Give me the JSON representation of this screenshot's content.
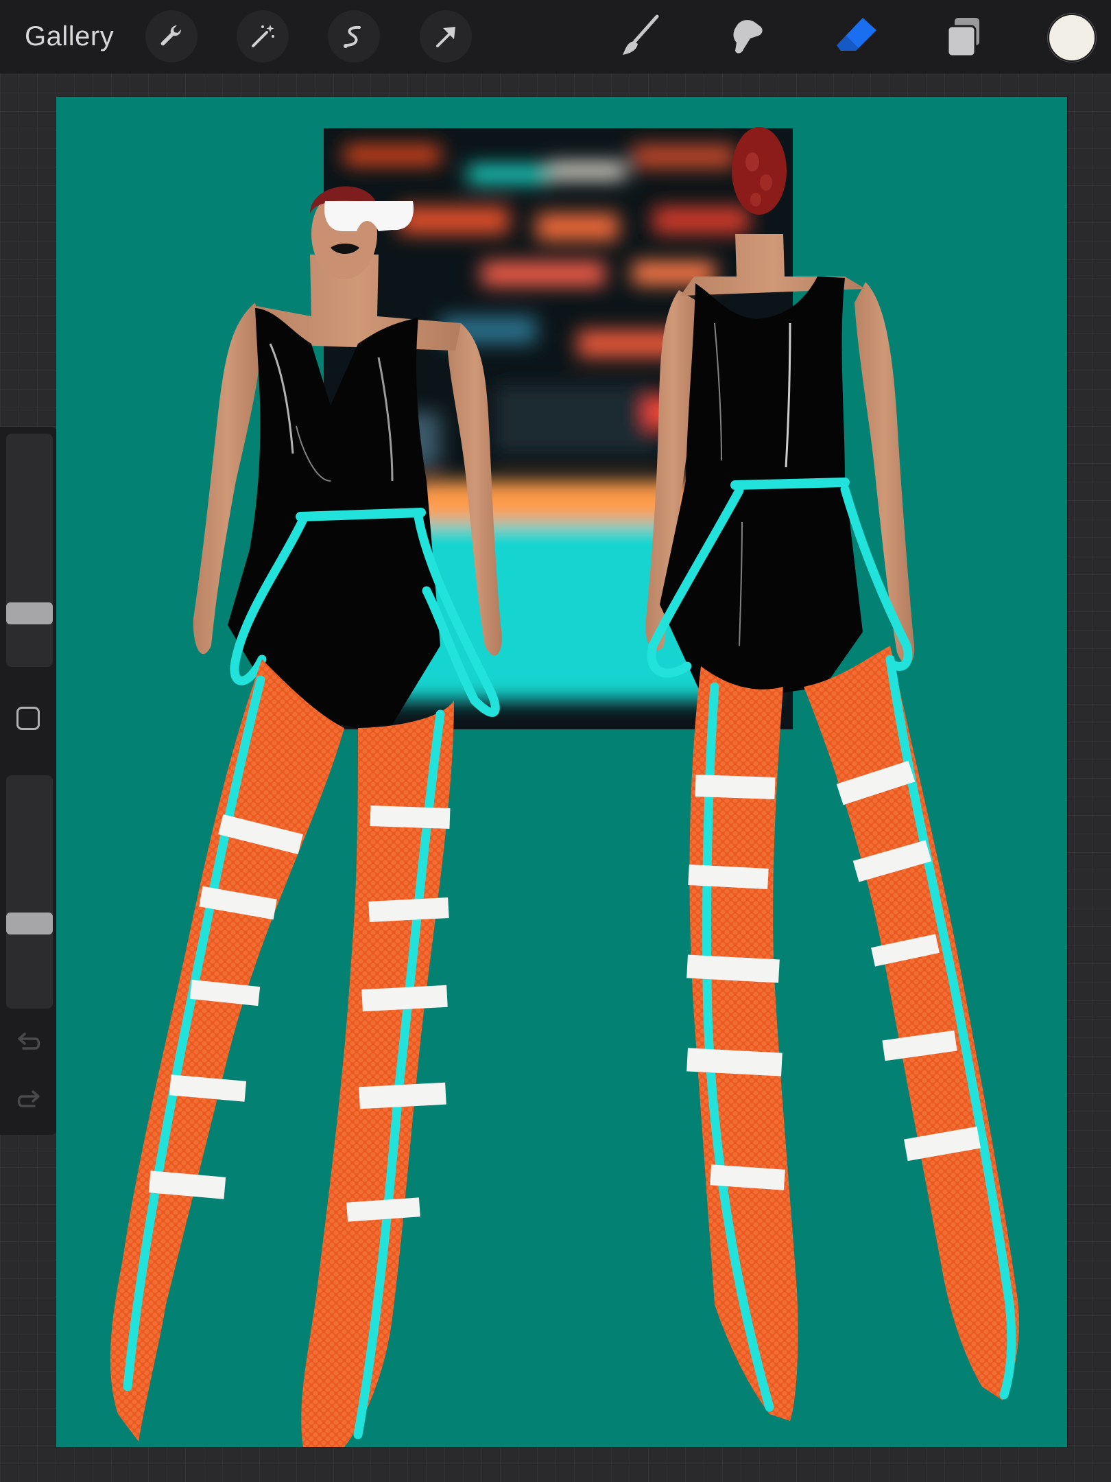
{
  "toolbar": {
    "gallery_label": "Gallery",
    "left_tools": [
      "wrench-icon",
      "magic-wand-icon",
      "selection-icon",
      "transform-arrow-icon"
    ],
    "right_tools": [
      "brush-icon",
      "smudge-icon",
      "eraser-icon",
      "layers-icon"
    ],
    "active_tool": "eraser",
    "active_tool_color": "#1a6ff0",
    "current_color": "#f1efe6"
  },
  "sidebar": {
    "brush_size_level": 0.2,
    "opacity_level": 0.35
  },
  "canvas": {
    "background_color": "#038274"
  }
}
